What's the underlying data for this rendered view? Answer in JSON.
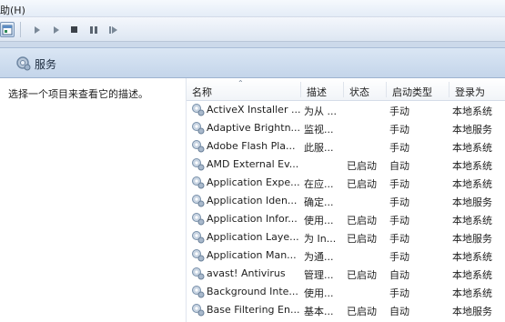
{
  "menu": {
    "help_label": "助(H)"
  },
  "header": {
    "title": "服务"
  },
  "left_pane": {
    "description_prompt": "选择一个项目来查看它的描述。"
  },
  "columns": {
    "name": "名称",
    "description": "描述",
    "status": "状态",
    "startup_type": "启动类型",
    "logon_as": "登录为"
  },
  "services": [
    {
      "name": "ActiveX Installer ...",
      "description": "为从 ...",
      "status": "",
      "startup_type": "手动",
      "logon_as": "本地系统"
    },
    {
      "name": "Adaptive Brightn...",
      "description": "监视...",
      "status": "",
      "startup_type": "手动",
      "logon_as": "本地服务"
    },
    {
      "name": "Adobe Flash Pla...",
      "description": "此服...",
      "status": "",
      "startup_type": "手动",
      "logon_as": "本地系统"
    },
    {
      "name": "AMD External Ev...",
      "description": "",
      "status": "已启动",
      "startup_type": "自动",
      "logon_as": "本地系统"
    },
    {
      "name": "Application Expe...",
      "description": "在应...",
      "status": "已启动",
      "startup_type": "手动",
      "logon_as": "本地系统"
    },
    {
      "name": "Application Iden...",
      "description": "确定...",
      "status": "",
      "startup_type": "手动",
      "logon_as": "本地服务"
    },
    {
      "name": "Application Infor...",
      "description": "使用...",
      "status": "已启动",
      "startup_type": "手动",
      "logon_as": "本地系统"
    },
    {
      "name": "Application Laye...",
      "description": "为 In...",
      "status": "已启动",
      "startup_type": "手动",
      "logon_as": "本地服务"
    },
    {
      "name": "Application Man...",
      "description": "为通...",
      "status": "",
      "startup_type": "手动",
      "logon_as": "本地系统"
    },
    {
      "name": "avast! Antivirus",
      "description": "管理...",
      "status": "已启动",
      "startup_type": "自动",
      "logon_as": "本地系统"
    },
    {
      "name": "Background Inte...",
      "description": "使用...",
      "status": "",
      "startup_type": "手动",
      "logon_as": "本地系统"
    },
    {
      "name": "Base Filtering En...",
      "description": "基本...",
      "status": "已启动",
      "startup_type": "自动",
      "logon_as": "本地服务"
    }
  ],
  "toolbar": {
    "icons": [
      "console-tree-icon",
      "start-icon",
      "start-alt-icon",
      "stop-icon",
      "pause-icon",
      "restart-icon"
    ]
  },
  "colors": {
    "header_band": "#c9d9ec",
    "accent": "#3a6ea5"
  }
}
